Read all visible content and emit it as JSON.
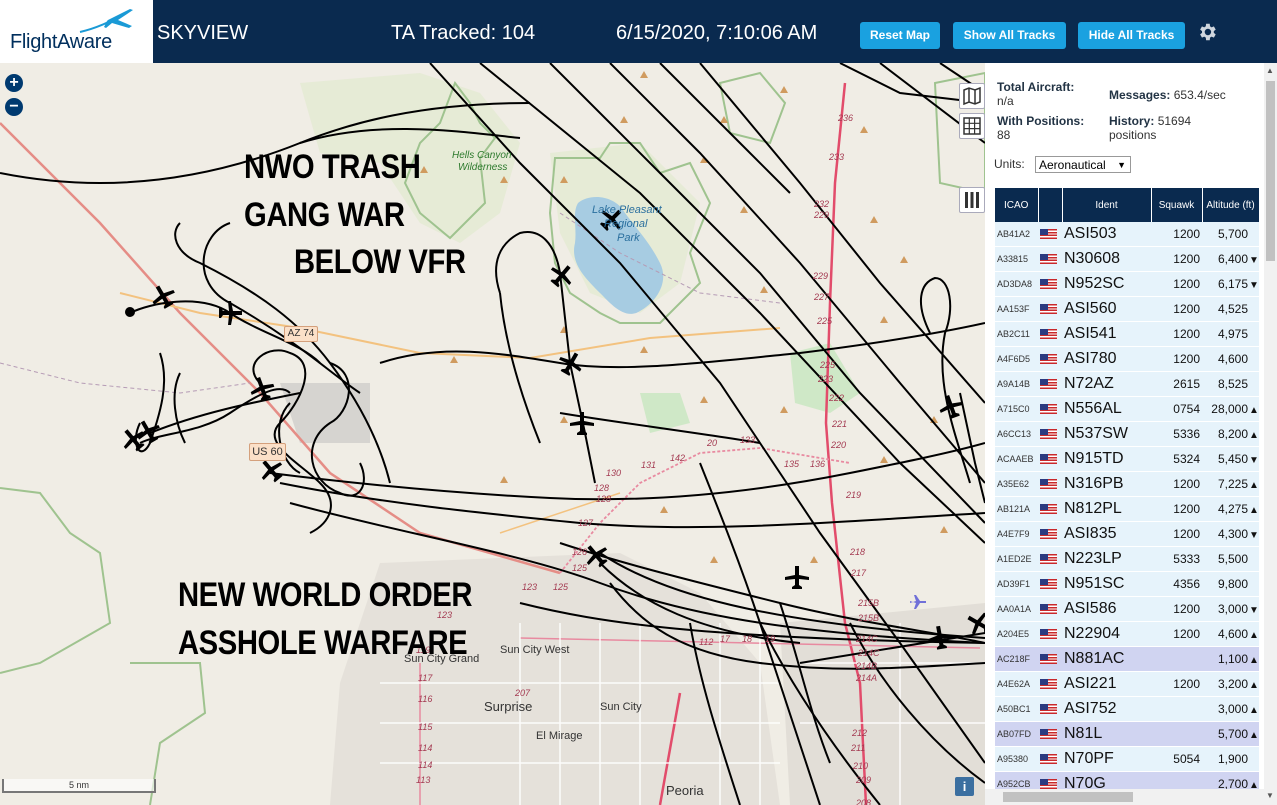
{
  "header": {
    "logo_text": "FlightAware",
    "title": "SKYVIEW",
    "tracked": "TA Tracked: 104",
    "datetime": "6/15/2020, 7:10:06 AM",
    "buttons": {
      "reset": "Reset Map",
      "show": "Show All Tracks",
      "hide": "Hide All Tracks"
    }
  },
  "map": {
    "overlay_lines": [
      "NWO TRASH",
      "GANG WAR",
      "BELOW VFR",
      "NEW WORLD ORDER",
      "ASSHOLE WARFARE"
    ],
    "zoom_in": "+",
    "zoom_out": "−",
    "scale_label": "5 nm",
    "info_label": "i",
    "place_labels": [
      "Hells Canyon",
      "Wilderness",
      "Lake Pleasant",
      "Regional",
      "Park",
      "Sun City Grand",
      "Sun City West",
      "Surprise",
      "Sun City",
      "El Mirage",
      "Peoria"
    ],
    "shields": [
      "AZ 74",
      "US 60"
    ],
    "road_numbers": [
      "236",
      "233",
      "232",
      "229",
      "229",
      "227",
      "225",
      "225",
      "223",
      "222",
      "221",
      "220",
      "219",
      "218",
      "217",
      "215B",
      "215B",
      "214C",
      "214C",
      "214B",
      "214A",
      "212",
      "211",
      "210",
      "209",
      "208",
      "207",
      "142",
      "131",
      "130",
      "128",
      "128",
      "127",
      "126",
      "125",
      "125",
      "123",
      "123",
      "119",
      "117",
      "116",
      "115",
      "114",
      "114",
      "113",
      "112",
      "17",
      "18",
      "19",
      "20",
      "133",
      "135",
      "136",
      "138 A/B"
    ]
  },
  "sidebar": {
    "total_label": "Total Aircraft:",
    "total_value": "n/a",
    "messages_label": "Messages:",
    "messages_value": "653.4/sec",
    "positions_label": "With Positions:",
    "positions_value": "88",
    "history_label": "History:",
    "history_value": "51694",
    "history_unit": "positions",
    "units_label": "Units:",
    "units_value": "Aeronautical",
    "columns": [
      "ICAO",
      "",
      "Ident",
      "Squawk",
      "Altitude (ft)"
    ],
    "rows": [
      {
        "icao": "AB41A2",
        "ident": "ASI503",
        "squawk": "1200",
        "alt": "5,700",
        "alt_icon": "",
        "alt_row": false
      },
      {
        "icao": "A33815",
        "ident": "N30608",
        "squawk": "1200",
        "alt": "6,400",
        "alt_icon": "▼",
        "alt_row": false
      },
      {
        "icao": "AD3DA8",
        "ident": "N952SC",
        "squawk": "1200",
        "alt": "6,175",
        "alt_icon": "▼",
        "alt_row": false
      },
      {
        "icao": "AA153F",
        "ident": "ASI560",
        "squawk": "1200",
        "alt": "4,525",
        "alt_icon": "",
        "alt_row": false
      },
      {
        "icao": "AB2C11",
        "ident": "ASI541",
        "squawk": "1200",
        "alt": "4,975",
        "alt_icon": "",
        "alt_row": false
      },
      {
        "icao": "A4F6D5",
        "ident": "ASI780",
        "squawk": "1200",
        "alt": "4,600",
        "alt_icon": "",
        "alt_row": false
      },
      {
        "icao": "A9A14B",
        "ident": "N72AZ",
        "squawk": "2615",
        "alt": "8,525",
        "alt_icon": "",
        "alt_row": false
      },
      {
        "icao": "A715C0",
        "ident": "N556AL",
        "squawk": "0754",
        "alt": "28,000",
        "alt_icon": "▲",
        "alt_row": false
      },
      {
        "icao": "A6CC13",
        "ident": "N537SW",
        "squawk": "5336",
        "alt": "8,200",
        "alt_icon": "▲",
        "alt_row": false
      },
      {
        "icao": "ACAAEB",
        "ident": "N915TD",
        "squawk": "5324",
        "alt": "5,450",
        "alt_icon": "▼",
        "alt_row": false
      },
      {
        "icao": "A35E62",
        "ident": "N316PB",
        "squawk": "1200",
        "alt": "7,225",
        "alt_icon": "▲",
        "alt_row": false
      },
      {
        "icao": "AB121A",
        "ident": "N812PL",
        "squawk": "1200",
        "alt": "4,275",
        "alt_icon": "▲",
        "alt_row": false
      },
      {
        "icao": "A4E7F9",
        "ident": "ASI835",
        "squawk": "1200",
        "alt": "4,300",
        "alt_icon": "▼",
        "alt_row": false
      },
      {
        "icao": "A1ED2E",
        "ident": "N223LP",
        "squawk": "5333",
        "alt": "5,500",
        "alt_icon": "",
        "alt_row": false
      },
      {
        "icao": "AD39F1",
        "ident": "N951SC",
        "squawk": "4356",
        "alt": "9,800",
        "alt_icon": "",
        "alt_row": false
      },
      {
        "icao": "AA0A1A",
        "ident": "ASI586",
        "squawk": "1200",
        "alt": "3,000",
        "alt_icon": "▼",
        "alt_row": false
      },
      {
        "icao": "A204E5",
        "ident": "N22904",
        "squawk": "1200",
        "alt": "4,600",
        "alt_icon": "▲",
        "alt_row": false
      },
      {
        "icao": "AC218F",
        "ident": "N881AC",
        "squawk": "",
        "alt": "1,100",
        "alt_icon": "▲",
        "alt_row": true
      },
      {
        "icao": "A4E62A",
        "ident": "ASI221",
        "squawk": "1200",
        "alt": "3,200",
        "alt_icon": "▲",
        "alt_row": false
      },
      {
        "icao": "A50BC1",
        "ident": "ASI752",
        "squawk": "",
        "alt": "3,000",
        "alt_icon": "▲",
        "alt_row": false
      },
      {
        "icao": "AB07FD",
        "ident": "N81L",
        "squawk": "",
        "alt": "5,700",
        "alt_icon": "▲",
        "alt_row": true
      },
      {
        "icao": "A95380",
        "ident": "N70PF",
        "squawk": "5054",
        "alt": "1,900",
        "alt_icon": "",
        "alt_row": false
      },
      {
        "icao": "A952CB",
        "ident": "N70G",
        "squawk": "",
        "alt": "2,700",
        "alt_icon": "▲",
        "alt_row": true
      }
    ]
  },
  "colors": {
    "header_bg": "#0a2a4f",
    "button_bg": "#1aa1e0",
    "row_bg": "#e6f3fb",
    "row_alt_bg": "#d0d4f1"
  }
}
